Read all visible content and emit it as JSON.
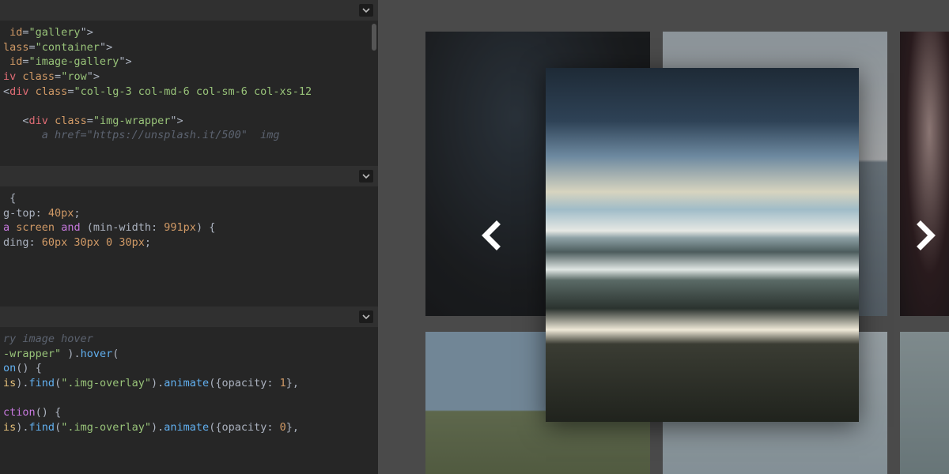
{
  "panels": {
    "html": {
      "lines": [
        [
          "tag_end"
        ],
        [
          "attr_id",
          "=",
          "str_gallery",
          "punct_close"
        ],
        [
          "attr_lass",
          "=",
          "str_container",
          "punct_close"
        ],
        [
          "attr_id",
          "=",
          "str_image-gallery",
          "punct_close"
        ],
        [
          "tag_iv",
          "sp",
          "attr_class",
          "=",
          "str_row",
          "punct_close"
        ],
        [
          "lt",
          "tag_div",
          "sp",
          "attr_class",
          "=",
          "str_cols"
        ],
        [
          "blank"
        ],
        [
          "indent",
          "lt",
          "tag_div",
          "sp",
          "attr_class",
          "=",
          "str_img-wrapper",
          "punct_close"
        ],
        [
          "truncated_a"
        ]
      ]
    },
    "css": {
      "lines": [
        [
          "sel_open"
        ],
        [
          "prop_g-top",
          ": ",
          "val_40px",
          "semi"
        ],
        [
          "kw_media",
          "sp",
          "kw_screen",
          "sp",
          "kw_and",
          "sp",
          "paren_open",
          "prop_min-width",
          ": ",
          "val_991px",
          "paren_close",
          "sp",
          "brace_open"
        ],
        [
          "prop_ding",
          ": ",
          "val_60_30_0_30",
          "semi"
        ],
        [
          "blank"
        ],
        [
          "blank"
        ]
      ]
    },
    "js": {
      "lines": [
        [
          "cmt_hover"
        ],
        [
          "str_wrapper",
          "sp",
          "paren_close",
          ".",
          "fn_hover",
          "punct_oparen"
        ],
        [
          "fn_on",
          "punct_oparen",
          "punct_cparen",
          "sp",
          "brace_open"
        ],
        [
          "this_is",
          "punct_cparen",
          ".",
          "fn_find",
          "punct_oparen",
          "str_img-overlay",
          "punct_cparen",
          ".",
          "fn_animate",
          "punct_oparen",
          "brace_open",
          "prop_opacity",
          ": ",
          "num_1",
          "brace_close",
          "comma"
        ],
        [
          "blank"
        ],
        [
          "fn_ction",
          "punct_oparen",
          "punct_cparen",
          "sp",
          "brace_open"
        ],
        [
          "this_is",
          "punct_cparen",
          ".",
          "fn_find",
          "punct_oparen",
          "str_img-overlay",
          "punct_cparen",
          ".",
          "fn_animate",
          "punct_oparen",
          "brace_open",
          "prop_opacity",
          ": ",
          "num_0",
          "brace_close",
          "comma"
        ]
      ]
    }
  },
  "tokens": {
    "tag_end": {
      "txt": "",
      "cls": "c-plain"
    },
    "attr_id": {
      "txt": " id",
      "cls": "c-attr"
    },
    "attr_lass": {
      "txt": "lass",
      "cls": "c-attr"
    },
    "attr_class": {
      "txt": "class",
      "cls": "c-attr"
    },
    "tag_iv": {
      "txt": "iv",
      "cls": "c-tag"
    },
    "tag_div": {
      "txt": "div",
      "cls": "c-tag"
    },
    "lt": {
      "txt": "<",
      "cls": "c-punct"
    },
    "sp": {
      "txt": " ",
      "cls": "c-plain"
    },
    "=": {
      "txt": "=",
      "cls": "c-punct"
    },
    "punct_close": {
      "txt": "\">",
      "cls": "c-punct"
    },
    "str_gallery": {
      "txt": "\"gallery",
      "cls": "c-str"
    },
    "str_container": {
      "txt": "\"container",
      "cls": "c-str"
    },
    "str_image-gallery": {
      "txt": "\"image-gallery",
      "cls": "c-str"
    },
    "str_row": {
      "txt": "\"row",
      "cls": "c-str"
    },
    "str_cols": {
      "txt": "\"col-lg-3 col-md-6 col-sm-6 col-xs-12",
      "cls": "c-str"
    },
    "str_img-wrapper": {
      "txt": "\"img-wrapper",
      "cls": "c-str"
    },
    "blank": {
      "txt": " ",
      "cls": "c-plain"
    },
    "indent": {
      "txt": "   ",
      "cls": "c-plain"
    },
    "truncated_a": {
      "txt": "      a href=\"https://unsplash.it/500\"  img",
      "cls": "c-cmt"
    },
    "sel_open": {
      "txt": " {",
      "cls": "c-plain"
    },
    "prop_g-top": {
      "txt": "g-top",
      "cls": "c-prop"
    },
    "prop_min-width": {
      "txt": "min-width",
      "cls": "c-prop"
    },
    "prop_ding": {
      "txt": "ding",
      "cls": "c-prop"
    },
    "prop_opacity": {
      "txt": "opacity",
      "cls": "c-prop"
    },
    ": ": {
      "txt": ": ",
      "cls": "c-plain"
    },
    "val_40px": {
      "txt": "40px",
      "cls": "c-val"
    },
    "val_991px": {
      "txt": "991px",
      "cls": "c-val"
    },
    "val_60_30_0_30": {
      "txt": "60px 30px 0 30px",
      "cls": "c-val"
    },
    "semi": {
      "txt": ";",
      "cls": "c-plain"
    },
    "kw_media": {
      "txt": "a",
      "cls": "c-pkw"
    },
    "kw_screen": {
      "txt": "screen",
      "cls": "c-val"
    },
    "kw_and": {
      "txt": "and",
      "cls": "c-pkw"
    },
    "paren_open": {
      "txt": "(",
      "cls": "c-plain"
    },
    "paren_close": {
      "txt": ")",
      "cls": "c-plain"
    },
    "brace_open": {
      "txt": "{",
      "cls": "c-plain"
    },
    "brace_close": {
      "txt": "}",
      "cls": "c-plain"
    },
    "cmt_hover": {
      "txt": "ry image hover",
      "cls": "c-cmt"
    },
    "str_wrapper": {
      "txt": "-wrapper\"",
      "cls": "c-str"
    },
    "str_img-overlay": {
      "txt": "\".img-overlay\"",
      "cls": "c-str"
    },
    ".": {
      "txt": ".",
      "cls": "c-plain"
    },
    "fn_hover": {
      "txt": "hover",
      "cls": "c-fn"
    },
    "fn_on": {
      "txt": "on",
      "cls": "c-fn"
    },
    "fn_ction": {
      "txt": "ction",
      "cls": "c-pkw"
    },
    "fn_find": {
      "txt": "find",
      "cls": "c-fn"
    },
    "fn_animate": {
      "txt": "animate",
      "cls": "c-fn"
    },
    "this_is": {
      "txt": "is",
      "cls": "c-this"
    },
    "punct_oparen": {
      "txt": "(",
      "cls": "c-plain"
    },
    "punct_cparen": {
      "txt": ")",
      "cls": "c-plain"
    },
    "num_1": {
      "txt": "1",
      "cls": "c-num"
    },
    "num_0": {
      "txt": "0",
      "cls": "c-num"
    },
    "comma": {
      "txt": ",",
      "cls": "c-plain"
    }
  },
  "icons": {
    "chevron_down": "chevron-down-icon",
    "chevron_left": "chevron-left-icon",
    "chevron_right": "chevron-right-icon"
  }
}
